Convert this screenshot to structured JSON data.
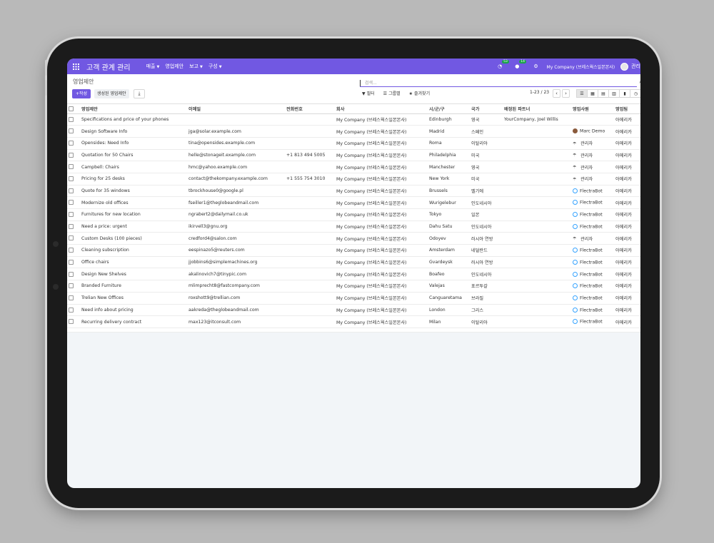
{
  "app": {
    "title": "고객 관계 관리",
    "menu": [
      "매출",
      "영업제안",
      "보고",
      "구성"
    ],
    "menu_caret": [
      true,
      false,
      true,
      true
    ],
    "activity_badge": "53",
    "messages_badge": "14",
    "company": "My Company (브레스웍스일본본사)",
    "user": "관리"
  },
  "control": {
    "breadcrumb": "영업제안",
    "search_placeholder": "검색...",
    "new_label": "작성",
    "generate_label": "생성된 영업제안",
    "filter_label": "필터",
    "group_label": "그룹별",
    "favorites_label": "즐겨찾기",
    "pager": "1-23 / 23"
  },
  "colors": {
    "brand": "#7158e2",
    "bot_ring": "#35a3ff"
  },
  "columns": [
    "영업제안",
    "이메일",
    "전화번호",
    "회사",
    "시/군/구",
    "국가",
    "배정된 파트너",
    "영업사원",
    "영업팀"
  ],
  "rows": [
    {
      "name": "Specifications and price of your phones",
      "email": "",
      "phone": "",
      "company": "My Company (브레스웍스일본본사)",
      "city": "Edinburgh",
      "country": "영국",
      "partner": "YourCompany, Joel Willis",
      "salesperson": "",
      "sp_type": "none",
      "team": "아메리카"
    },
    {
      "name": "Design Software Info",
      "email": "jga@solar.example.com",
      "phone": "",
      "company": "My Company (브레스웍스일본본사)",
      "city": "Madrid",
      "country": "스페인",
      "partner": "",
      "salesperson": "Marc Demo",
      "sp_type": "marc",
      "team": "아메리카"
    },
    {
      "name": "Opensides: Need Info",
      "email": "tina@opensides.example.com",
      "phone": "",
      "company": "My Company (브레스웍스일본본사)",
      "city": "Roma",
      "country": "이탈리아",
      "partner": "",
      "salesperson": "관리자",
      "sp_type": "admin",
      "team": "아메리카"
    },
    {
      "name": "Quotation for 50 Chairs",
      "email": "helle@stonageit.example.com",
      "phone": "+1 813 494 5005",
      "company": "My Company (브레스웍스일본본사)",
      "city": "Philadelphia",
      "country": "미국",
      "partner": "",
      "salesperson": "관리자",
      "sp_type": "admin",
      "team": "아메리카"
    },
    {
      "name": "Campbell: Chairs",
      "email": "hmc@yahoo.example.com",
      "phone": "",
      "company": "My Company (브레스웍스일본본사)",
      "city": "Manchester",
      "country": "영국",
      "partner": "",
      "salesperson": "관리자",
      "sp_type": "admin",
      "team": "아메리카"
    },
    {
      "name": "Pricing for 25 desks",
      "email": "contact@thekompany.example.com",
      "phone": "+1 555 754 3010",
      "company": "My Company (브레스웍스일본본사)",
      "city": "New York",
      "country": "미국",
      "partner": "",
      "salesperson": "관리자",
      "sp_type": "admin",
      "team": "아메리카"
    },
    {
      "name": "Quote for 35 windows",
      "email": "tbrockhouse0@google.pl",
      "phone": "",
      "company": "My Company (브레스웍스일본본사)",
      "city": "Brussels",
      "country": "벨기에",
      "partner": "",
      "salesperson": "FlectraBot",
      "sp_type": "bot",
      "team": "아메리카"
    },
    {
      "name": "Modernize old offices",
      "email": "fseiller1@theglobeandmail.com",
      "phone": "",
      "company": "My Company (브레스웍스일본본사)",
      "city": "Wurigelebur",
      "country": "인도네시아",
      "partner": "",
      "salesperson": "FlectraBot",
      "sp_type": "bot",
      "team": "아메리카"
    },
    {
      "name": "Furnitures for new location",
      "email": "ngrabert2@dailymail.co.uk",
      "phone": "",
      "company": "My Company (브레스웍스일본본사)",
      "city": "Tokyo",
      "country": "일본",
      "partner": "",
      "salesperson": "FlectraBot",
      "sp_type": "bot",
      "team": "아메리카"
    },
    {
      "name": "Need a price: urgent",
      "email": "ikirvell3@gnu.org",
      "phone": "",
      "company": "My Company (브레스웍스일본본사)",
      "city": "Dahu Satu",
      "country": "인도네시아",
      "partner": "",
      "salesperson": "FlectraBot",
      "sp_type": "bot",
      "team": "아메리카"
    },
    {
      "name": "Custom Desks (100 pieces)",
      "email": "credford4@salon.com",
      "phone": "",
      "company": "My Company (브레스웍스일본본사)",
      "city": "Odoyev",
      "country": "러시아 연방",
      "partner": "",
      "salesperson": "관리자",
      "sp_type": "admin",
      "team": "아메리카"
    },
    {
      "name": "Cleaning subscription",
      "email": "eespinazo5@reuters.com",
      "phone": "",
      "company": "My Company (브레스웍스일본본사)",
      "city": "Amsterdam",
      "country": "네덜란드",
      "partner": "",
      "salesperson": "FlectraBot",
      "sp_type": "bot",
      "team": "아메리카"
    },
    {
      "name": "Office chairs",
      "email": "jjobbins6@simplemachines.org",
      "phone": "",
      "company": "My Company (브레스웍스일본본사)",
      "city": "Gvardeysk",
      "country": "러시아 연방",
      "partner": "",
      "salesperson": "FlectraBot",
      "sp_type": "bot",
      "team": "아메리카"
    },
    {
      "name": "Design New Shelves",
      "email": "akalinovich7@tinypic.com",
      "phone": "",
      "company": "My Company (브레스웍스일본본사)",
      "city": "Boafeo",
      "country": "인도네시아",
      "partner": "",
      "salesperson": "FlectraBot",
      "sp_type": "bot",
      "team": "아메리카"
    },
    {
      "name": "Branded Furniture",
      "email": "mlimprecht8@fastcompany.com",
      "phone": "",
      "company": "My Company (브레스웍스일본본사)",
      "city": "Valejas",
      "country": "포르투갈",
      "partner": "",
      "salesperson": "FlectraBot",
      "sp_type": "bot",
      "team": "아메리카"
    },
    {
      "name": "Trelian New Offices",
      "email": "roxshott9@trellian.com",
      "phone": "",
      "company": "My Company (브레스웍스일본본사)",
      "city": "Canguaretama",
      "country": "브라질",
      "partner": "",
      "salesperson": "FlectraBot",
      "sp_type": "bot",
      "team": "아메리카"
    },
    {
      "name": "Need info about pricing",
      "email": "aakreda@theglobeandmail.com",
      "phone": "",
      "company": "My Company (브레스웍스일본본사)",
      "city": "London",
      "country": "그리스",
      "partner": "",
      "salesperson": "FlectraBot",
      "sp_type": "bot",
      "team": "아메리카"
    },
    {
      "name": "Recurring delivery contract",
      "email": "max123@itconsult.com",
      "phone": "",
      "company": "My Company (브레스웍스일본본사)",
      "city": "Milan",
      "country": "이탈리아",
      "partner": "",
      "salesperson": "FlectraBot",
      "sp_type": "bot",
      "team": "아메리카"
    }
  ]
}
